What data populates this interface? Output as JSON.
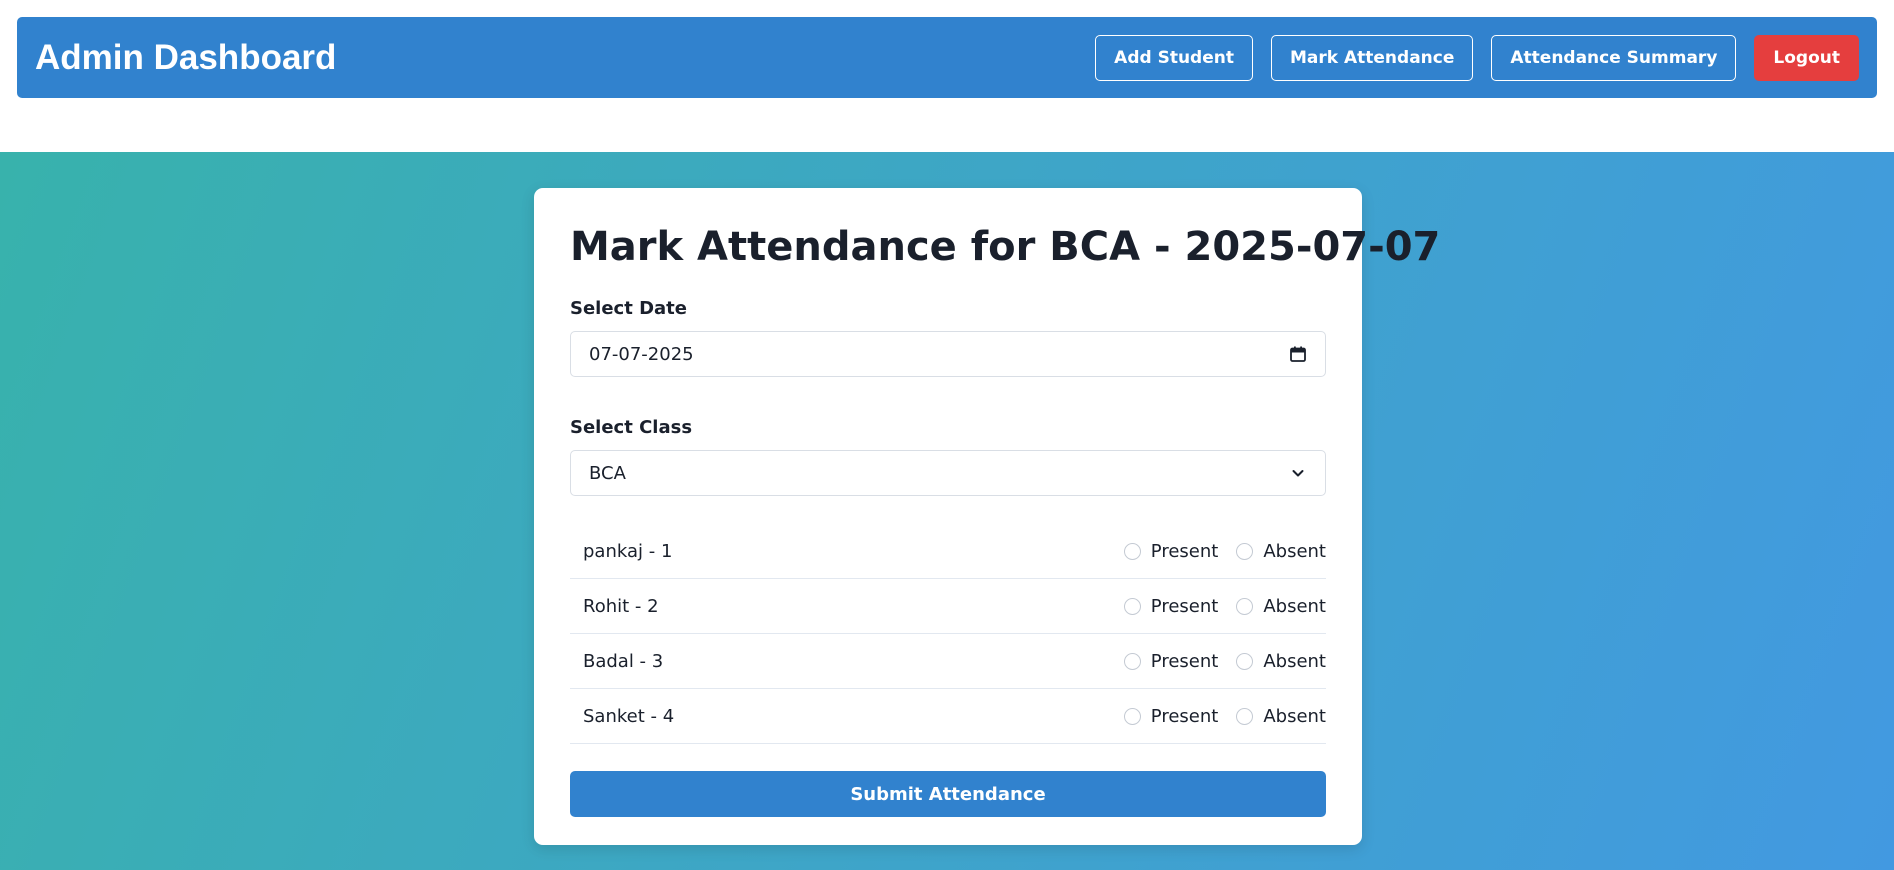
{
  "navbar": {
    "title": "Admin Dashboard",
    "buttons": {
      "add_student": "Add Student",
      "mark_attendance": "Mark Attendance",
      "attendance_summary": "Attendance Summary",
      "logout": "Logout"
    }
  },
  "form": {
    "title": "Mark Attendance for BCA - 2025-07-07",
    "date_label": "Select Date",
    "date_value": "07-07-2025",
    "class_label": "Select Class",
    "class_value": "BCA",
    "students": [
      {
        "name": "pankaj - 1"
      },
      {
        "name": "Rohit - 2"
      },
      {
        "name": "Badal - 3"
      },
      {
        "name": "Sanket - 4"
      }
    ],
    "present_label": "Present",
    "absent_label": "Absent",
    "submit_label": "Submit Attendance"
  },
  "colors": {
    "primary": "#3182ce",
    "danger": "#e53e3e",
    "gradient_start": "#38b2ac",
    "gradient_end": "#4299e1"
  }
}
